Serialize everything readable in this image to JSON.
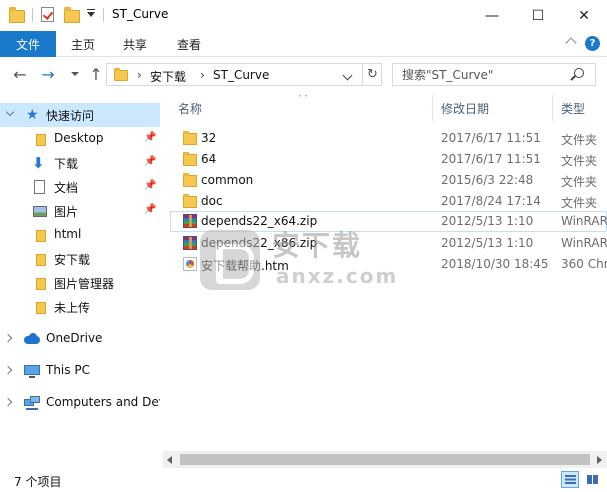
{
  "window": {
    "title": "ST_Curve",
    "minimize": "—",
    "maximize": "☐",
    "close": "✕"
  },
  "ribbon": {
    "file_tab": "文件",
    "tabs": [
      "主页",
      "共享",
      "查看"
    ],
    "help": "?"
  },
  "address": {
    "breadcrumbs": [
      "安下载",
      "ST_Curve"
    ],
    "search_placeholder": "搜索\"ST_Curve\""
  },
  "sidebar": {
    "quick_access": "快速访问",
    "pinned": [
      "Desktop",
      "下载",
      "文档",
      "图片"
    ],
    "folders": [
      "html",
      "安下载",
      "图片管理器",
      "未上传"
    ],
    "onedrive": "OneDrive",
    "this_pc": "This PC",
    "network": "Computers and Devices"
  },
  "columns": {
    "name": "名称",
    "date": "修改日期",
    "type": "类型"
  },
  "files": [
    {
      "name": "32",
      "date": "2017/6/17 11:51",
      "type": "文件夹",
      "icon": "folder-icon"
    },
    {
      "name": "64",
      "date": "2017/6/17 11:51",
      "type": "文件夹",
      "icon": "folder-icon"
    },
    {
      "name": "common",
      "date": "2015/6/3 22:48",
      "type": "文件夹",
      "icon": "folder-icon"
    },
    {
      "name": "doc",
      "date": "2017/8/24 17:14",
      "type": "文件夹",
      "icon": "folder-icon"
    },
    {
      "name": "depends22_x64.zip",
      "date": "2012/5/13 1:10",
      "type": "WinRAR",
      "icon": "winrar-archive-icon"
    },
    {
      "name": "depends22_x86.zip",
      "date": "2012/5/13 1:10",
      "type": "WinRAR",
      "icon": "winrar-archive-icon"
    },
    {
      "name": "安下载帮助.htm",
      "date": "2018/10/30 18:45",
      "type": "360 Chr",
      "icon": "html-document-icon"
    }
  ],
  "watermark": {
    "cn": "安下载",
    "en": "anxz.com"
  },
  "status": {
    "item_count": "7 个项目"
  }
}
